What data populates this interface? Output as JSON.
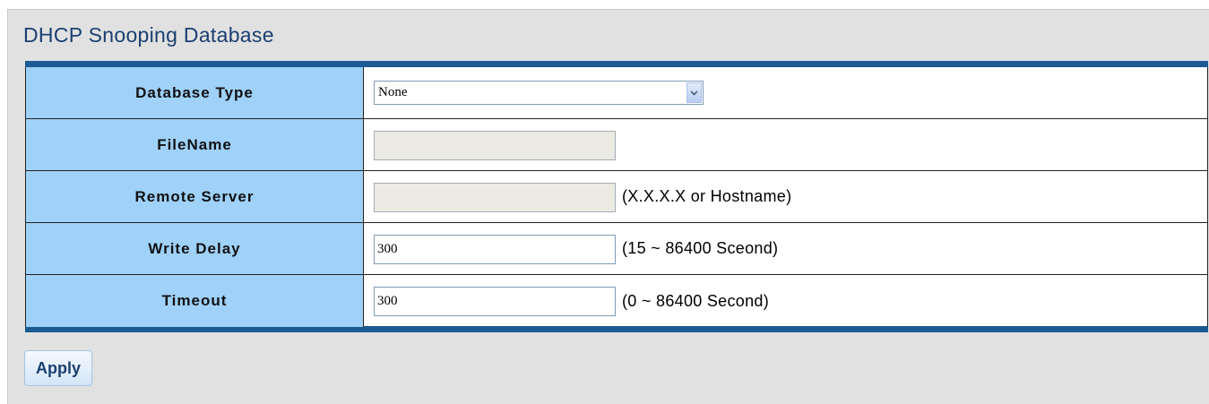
{
  "page": {
    "title": "DHCP Snooping Database"
  },
  "form": {
    "database_type": {
      "label": "Database Type",
      "selected": "None",
      "icon": "chevron-down-icon"
    },
    "filename": {
      "label": "FileName",
      "value": ""
    },
    "remote_server": {
      "label": "Remote Server",
      "value": "",
      "hint": "(X.X.X.X or Hostname)"
    },
    "write_delay": {
      "label": "Write Delay",
      "value": "300",
      "hint": "(15 ~ 86400 Sceond)"
    },
    "timeout": {
      "label": "Timeout",
      "value": "300",
      "hint": "(0 ~ 86400 Second)"
    }
  },
  "actions": {
    "apply_label": "Apply"
  },
  "colors": {
    "label_cell_bg": "#9fd1f9",
    "table_border_accent": "#1c5a94",
    "title_color": "#1b3f71",
    "panel_bg": "#e1e1e1",
    "disabled_field_bg": "#ebebe4"
  }
}
